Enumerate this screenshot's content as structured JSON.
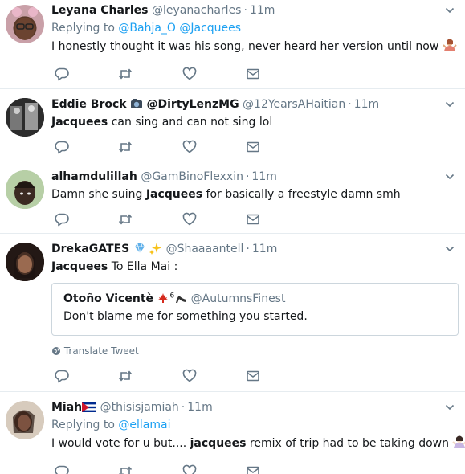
{
  "tweets": [
    {
      "name": "Leyana Charles",
      "handle": "@leyanacharles",
      "time": "11m",
      "replying_prefix": "Replying to",
      "replying_to": [
        "@Bahja_O",
        "@Jacquees"
      ],
      "text": "I honestly thought it was his song, never heard her version until now"
    },
    {
      "name": "Eddie Brock",
      "name_suffix": "@DirtyLenzMG",
      "handle": "@12YearsAHaitian",
      "time": "11m",
      "text_bold": "Jacquees",
      "text_rest": " can sing and can not sing lol"
    },
    {
      "name": "alhamdulillah",
      "handle": "@GamBinoFlexxin",
      "time": "11m",
      "text_pre": "Damn she suing ",
      "text_bold": "Jacquees",
      "text_rest": " for basically a freestyle damn smh"
    },
    {
      "name": "DrekaGATES",
      "handle": "@Shaaaantell",
      "time": "11m",
      "text_bold": "Jacquees",
      "text_rest": " To Ella Mai :",
      "quote": {
        "name": "Otoño Vicentè",
        "superscript": "6",
        "handle": "@AutumnsFinest",
        "text": "Don't blame me for something you started."
      },
      "translate": "Translate Tweet"
    },
    {
      "name": "Miah",
      "handle": "@thisisjamiah",
      "time": "11m",
      "replying_prefix": "Replying to",
      "replying_to": [
        "@ellamai"
      ],
      "text_pre": "I would vote for u but.... ",
      "text_bold": "jacquees",
      "text_rest": " remix of trip had to be taking down"
    }
  ],
  "icons": [
    "reply-icon",
    "retweet-icon",
    "like-icon",
    "message-icon",
    "chevron-down-icon",
    "globe-icon"
  ],
  "colors": {
    "link": "#1da1f2",
    "muted": "#657786",
    "border": "#e6ecf0",
    "text": "#14171a"
  }
}
